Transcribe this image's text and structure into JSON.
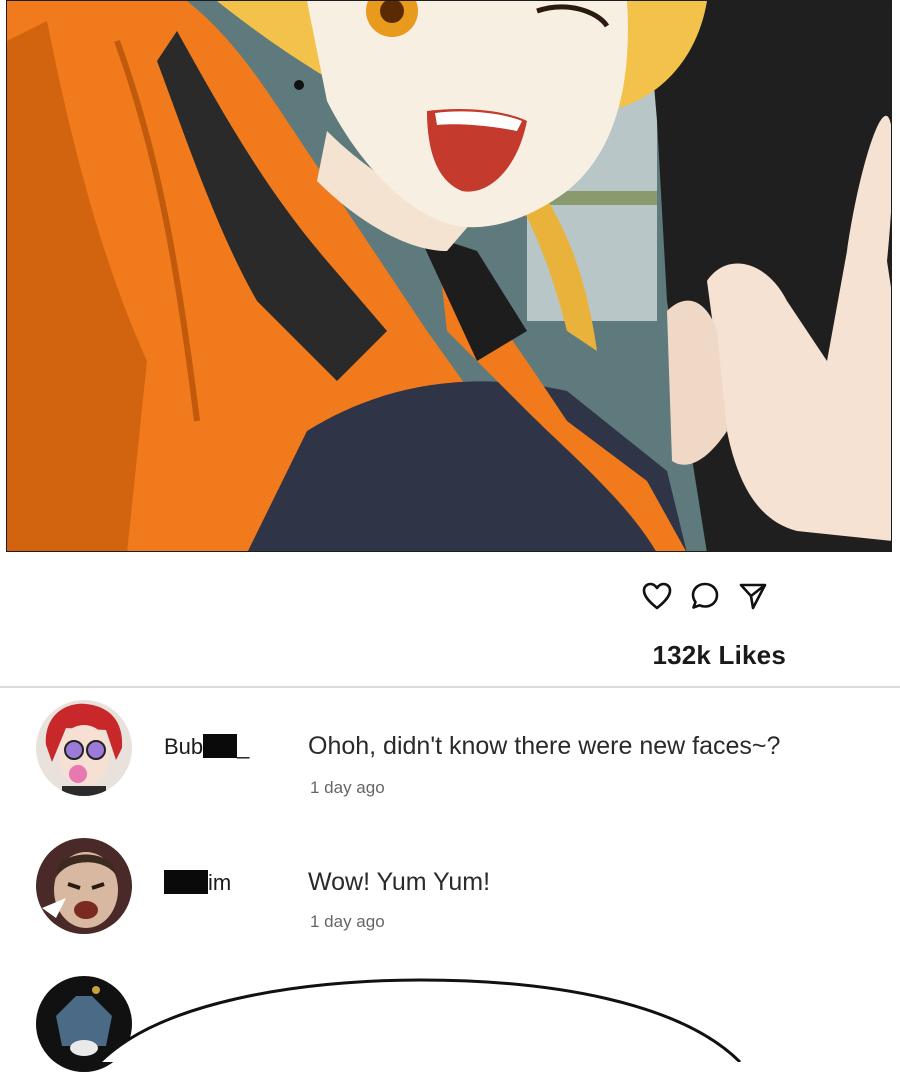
{
  "post": {
    "image_alt": "Anime panel: smiling blonde girl in orange jacket winking and pointing",
    "likes_label": "132k Likes"
  },
  "actions": {
    "like_icon": "heart-icon",
    "comment_icon": "comment-bubble-icon",
    "share_icon": "send-icon"
  },
  "comments": [
    {
      "username_visible": "Bub",
      "username_suffix": "_",
      "text": "Ohoh, didn't know there were new faces~?",
      "time": "1 day ago"
    },
    {
      "username_visible": "",
      "username_suffix": "im",
      "text": "Wow! Yum Yum!",
      "time": "1 day ago"
    }
  ],
  "colors": {
    "accent_orange": "#f07a1c",
    "text": "#1a1a1a",
    "divider": "#dcdcdc"
  }
}
